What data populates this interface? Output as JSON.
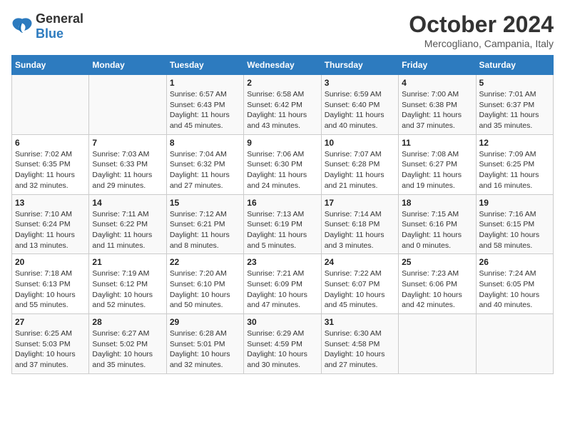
{
  "header": {
    "logo_general": "General",
    "logo_blue": "Blue",
    "month_title": "October 2024",
    "location": "Mercogliano, Campania, Italy"
  },
  "calendar": {
    "days_of_week": [
      "Sunday",
      "Monday",
      "Tuesday",
      "Wednesday",
      "Thursday",
      "Friday",
      "Saturday"
    ],
    "weeks": [
      [
        {
          "day": null
        },
        {
          "day": null
        },
        {
          "day": "1",
          "sunrise": "Sunrise: 6:57 AM",
          "sunset": "Sunset: 6:43 PM",
          "daylight": "Daylight: 11 hours and 45 minutes."
        },
        {
          "day": "2",
          "sunrise": "Sunrise: 6:58 AM",
          "sunset": "Sunset: 6:42 PM",
          "daylight": "Daylight: 11 hours and 43 minutes."
        },
        {
          "day": "3",
          "sunrise": "Sunrise: 6:59 AM",
          "sunset": "Sunset: 6:40 PM",
          "daylight": "Daylight: 11 hours and 40 minutes."
        },
        {
          "day": "4",
          "sunrise": "Sunrise: 7:00 AM",
          "sunset": "Sunset: 6:38 PM",
          "daylight": "Daylight: 11 hours and 37 minutes."
        },
        {
          "day": "5",
          "sunrise": "Sunrise: 7:01 AM",
          "sunset": "Sunset: 6:37 PM",
          "daylight": "Daylight: 11 hours and 35 minutes."
        }
      ],
      [
        {
          "day": "6",
          "sunrise": "Sunrise: 7:02 AM",
          "sunset": "Sunset: 6:35 PM",
          "daylight": "Daylight: 11 hours and 32 minutes."
        },
        {
          "day": "7",
          "sunrise": "Sunrise: 7:03 AM",
          "sunset": "Sunset: 6:33 PM",
          "daylight": "Daylight: 11 hours and 29 minutes."
        },
        {
          "day": "8",
          "sunrise": "Sunrise: 7:04 AM",
          "sunset": "Sunset: 6:32 PM",
          "daylight": "Daylight: 11 hours and 27 minutes."
        },
        {
          "day": "9",
          "sunrise": "Sunrise: 7:06 AM",
          "sunset": "Sunset: 6:30 PM",
          "daylight": "Daylight: 11 hours and 24 minutes."
        },
        {
          "day": "10",
          "sunrise": "Sunrise: 7:07 AM",
          "sunset": "Sunset: 6:28 PM",
          "daylight": "Daylight: 11 hours and 21 minutes."
        },
        {
          "day": "11",
          "sunrise": "Sunrise: 7:08 AM",
          "sunset": "Sunset: 6:27 PM",
          "daylight": "Daylight: 11 hours and 19 minutes."
        },
        {
          "day": "12",
          "sunrise": "Sunrise: 7:09 AM",
          "sunset": "Sunset: 6:25 PM",
          "daylight": "Daylight: 11 hours and 16 minutes."
        }
      ],
      [
        {
          "day": "13",
          "sunrise": "Sunrise: 7:10 AM",
          "sunset": "Sunset: 6:24 PM",
          "daylight": "Daylight: 11 hours and 13 minutes."
        },
        {
          "day": "14",
          "sunrise": "Sunrise: 7:11 AM",
          "sunset": "Sunset: 6:22 PM",
          "daylight": "Daylight: 11 hours and 11 minutes."
        },
        {
          "day": "15",
          "sunrise": "Sunrise: 7:12 AM",
          "sunset": "Sunset: 6:21 PM",
          "daylight": "Daylight: 11 hours and 8 minutes."
        },
        {
          "day": "16",
          "sunrise": "Sunrise: 7:13 AM",
          "sunset": "Sunset: 6:19 PM",
          "daylight": "Daylight: 11 hours and 5 minutes."
        },
        {
          "day": "17",
          "sunrise": "Sunrise: 7:14 AM",
          "sunset": "Sunset: 6:18 PM",
          "daylight": "Daylight: 11 hours and 3 minutes."
        },
        {
          "day": "18",
          "sunrise": "Sunrise: 7:15 AM",
          "sunset": "Sunset: 6:16 PM",
          "daylight": "Daylight: 11 hours and 0 minutes."
        },
        {
          "day": "19",
          "sunrise": "Sunrise: 7:16 AM",
          "sunset": "Sunset: 6:15 PM",
          "daylight": "Daylight: 10 hours and 58 minutes."
        }
      ],
      [
        {
          "day": "20",
          "sunrise": "Sunrise: 7:18 AM",
          "sunset": "Sunset: 6:13 PM",
          "daylight": "Daylight: 10 hours and 55 minutes."
        },
        {
          "day": "21",
          "sunrise": "Sunrise: 7:19 AM",
          "sunset": "Sunset: 6:12 PM",
          "daylight": "Daylight: 10 hours and 52 minutes."
        },
        {
          "day": "22",
          "sunrise": "Sunrise: 7:20 AM",
          "sunset": "Sunset: 6:10 PM",
          "daylight": "Daylight: 10 hours and 50 minutes."
        },
        {
          "day": "23",
          "sunrise": "Sunrise: 7:21 AM",
          "sunset": "Sunset: 6:09 PM",
          "daylight": "Daylight: 10 hours and 47 minutes."
        },
        {
          "day": "24",
          "sunrise": "Sunrise: 7:22 AM",
          "sunset": "Sunset: 6:07 PM",
          "daylight": "Daylight: 10 hours and 45 minutes."
        },
        {
          "day": "25",
          "sunrise": "Sunrise: 7:23 AM",
          "sunset": "Sunset: 6:06 PM",
          "daylight": "Daylight: 10 hours and 42 minutes."
        },
        {
          "day": "26",
          "sunrise": "Sunrise: 7:24 AM",
          "sunset": "Sunset: 6:05 PM",
          "daylight": "Daylight: 10 hours and 40 minutes."
        }
      ],
      [
        {
          "day": "27",
          "sunrise": "Sunrise: 6:25 AM",
          "sunset": "Sunset: 5:03 PM",
          "daylight": "Daylight: 10 hours and 37 minutes."
        },
        {
          "day": "28",
          "sunrise": "Sunrise: 6:27 AM",
          "sunset": "Sunset: 5:02 PM",
          "daylight": "Daylight: 10 hours and 35 minutes."
        },
        {
          "day": "29",
          "sunrise": "Sunrise: 6:28 AM",
          "sunset": "Sunset: 5:01 PM",
          "daylight": "Daylight: 10 hours and 32 minutes."
        },
        {
          "day": "30",
          "sunrise": "Sunrise: 6:29 AM",
          "sunset": "Sunset: 4:59 PM",
          "daylight": "Daylight: 10 hours and 30 minutes."
        },
        {
          "day": "31",
          "sunrise": "Sunrise: 6:30 AM",
          "sunset": "Sunset: 4:58 PM",
          "daylight": "Daylight: 10 hours and 27 minutes."
        },
        {
          "day": null
        },
        {
          "day": null
        }
      ]
    ]
  }
}
